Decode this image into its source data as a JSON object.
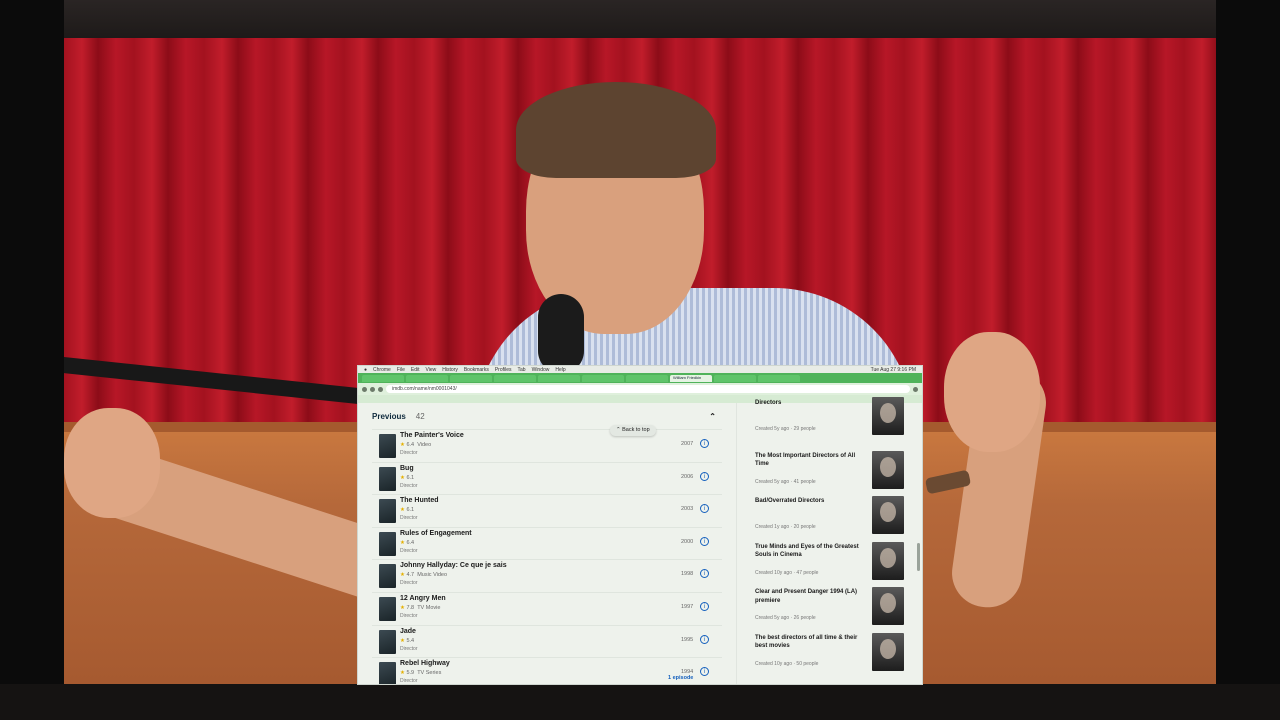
{
  "browser": {
    "menu_items": [
      "Chrome",
      "File",
      "Edit",
      "View",
      "History",
      "Bookmarks",
      "Profiles",
      "Tab",
      "Window",
      "Help"
    ],
    "clock": "Tue Aug 27 9:16 PM",
    "url": "imdb.com/name/nm0001043/",
    "active_tab": "William Friedkin"
  },
  "previous": {
    "label": "Previous",
    "count": "42",
    "back_to_top": "Back to top",
    "items": [
      {
        "title": "The Painter's Voice",
        "rating": "6.4",
        "type": "Video",
        "role": "Director",
        "year": "2007",
        "episodes": ""
      },
      {
        "title": "Bug",
        "rating": "6.1",
        "type": "",
        "role": "Director",
        "year": "2006",
        "episodes": ""
      },
      {
        "title": "The Hunted",
        "rating": "6.1",
        "type": "",
        "role": "Director",
        "year": "2003",
        "episodes": ""
      },
      {
        "title": "Rules of Engagement",
        "rating": "6.4",
        "type": "",
        "role": "Director",
        "year": "2000",
        "episodes": ""
      },
      {
        "title": "Johnny Hallyday: Ce que je sais",
        "rating": "4.7",
        "type": "Music Video",
        "role": "Director",
        "year": "1998",
        "episodes": ""
      },
      {
        "title": "12 Angry Men",
        "rating": "7.8",
        "type": "TV Movie",
        "role": "Director",
        "year": "1997",
        "episodes": ""
      },
      {
        "title": "Jade",
        "rating": "5.4",
        "type": "",
        "role": "Director",
        "year": "1995",
        "episodes": ""
      },
      {
        "title": "Rebel Highway",
        "rating": "5.9",
        "type": "TV Series",
        "role": "Director",
        "year": "1994",
        "episodes": "1 episode"
      }
    ]
  },
  "lists": [
    {
      "title": "Directors",
      "meta": "Created 5y ago · 29 people"
    },
    {
      "title": "The Most Important Directors of All Time",
      "meta": "Created 5y ago · 41 people"
    },
    {
      "title": "Bad/Overrated Directors",
      "meta": "Created 1y ago · 20 people"
    },
    {
      "title": "True Minds and Eyes of the Greatest Souls in Cinema",
      "meta": "Created 10y ago · 47 people"
    },
    {
      "title": "Clear and Present Danger 1994 (LA) premiere",
      "meta": "Created 5y ago · 26 people"
    },
    {
      "title": "The best directors of all time & their best movies",
      "meta": "Created 10y ago · 50 people"
    }
  ],
  "colors": {
    "tab_bar": "#4fb35a",
    "link_blue": "#1560bd",
    "star": "#e5b000",
    "curtain": "#b71727"
  }
}
